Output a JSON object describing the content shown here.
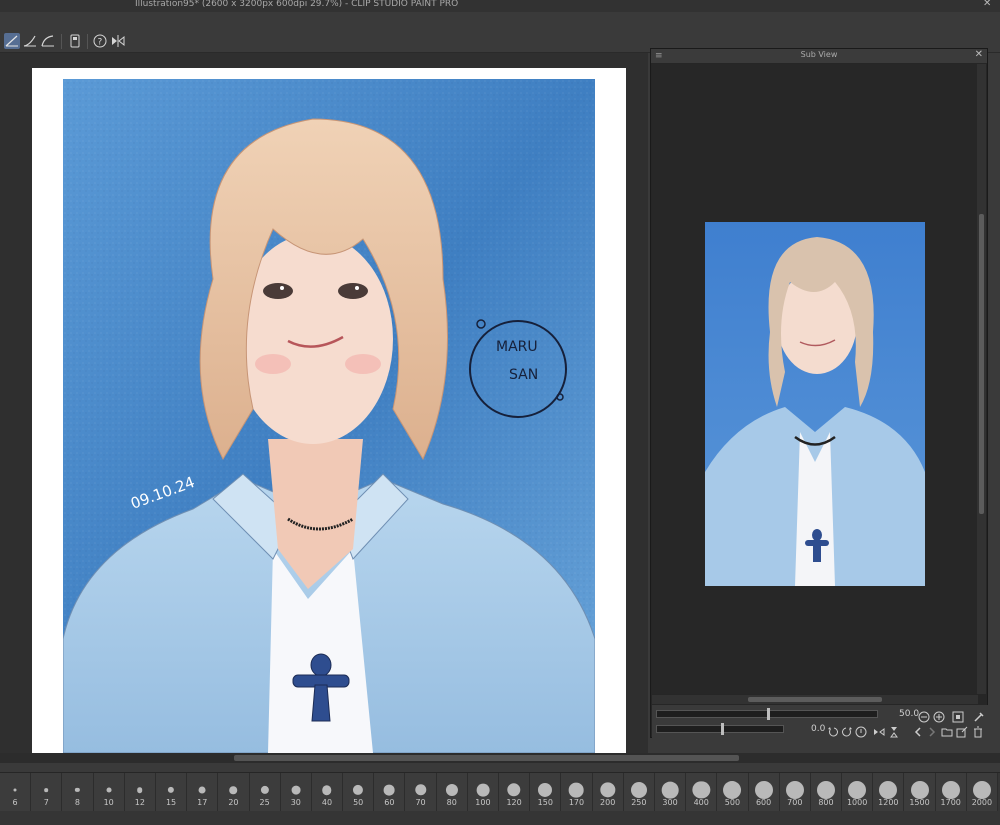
{
  "window": {
    "title": "Illustration95* (2600 x 3200px 600dpi 29.7%)  - CLIP STUDIO PAINT PRO",
    "close_glyph": "✕"
  },
  "toolbar": {
    "icons": [
      "pen-pressure-icon",
      "pen-pressure-icon",
      "pen-pressure-icon",
      "tablet-icon",
      "help-icon",
      "flip-icon"
    ]
  },
  "subview": {
    "title": "Sub View",
    "zoom_value": "50.0",
    "rotate_value": "0.0"
  },
  "brush_sizes": [
    "6",
    "7",
    "8",
    "10",
    "12",
    "15",
    "17",
    "20",
    "25",
    "30",
    "40",
    "50",
    "60",
    "70",
    "80",
    "100",
    "120",
    "150",
    "170",
    "200",
    "250",
    "300",
    "400",
    "500",
    "600",
    "700",
    "800",
    "1000",
    "1200",
    "1500",
    "1700",
    "2000"
  ],
  "colors": {
    "accent": "#566e93",
    "panel_bg": "#3a3a3a",
    "canvas_bg": "#2f2f2f",
    "artwork_bg": "#4f8ccb",
    "shirt": "#a9cbe6",
    "hair": "#e9c6a8"
  },
  "artwork": {
    "signature_line1": "MARU",
    "signature_line2": "SAN",
    "date": "09.10.24"
  }
}
